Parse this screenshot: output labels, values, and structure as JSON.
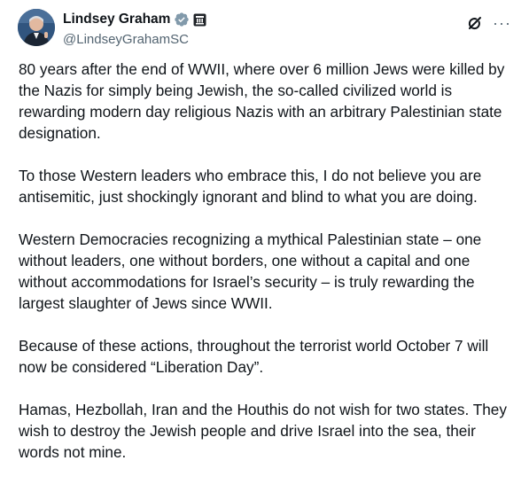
{
  "author": {
    "display_name": "Lindsey Graham",
    "handle": "@LindseyGrahamSC",
    "verified_color": "#829AAB"
  },
  "icons": {
    "verified": "verified-badge-icon",
    "affiliation": "government-affiliation-icon",
    "grok": "grok-icon",
    "more": "more-options-icon"
  },
  "tweet": {
    "paragraphs": [
      "80 years after the end of WWII, where over 6 million Jews were killed by the Nazis for simply being Jewish, the so-called civilized world is rewarding modern day religious Nazis with an arbitrary Palestinian state designation.",
      "To those Western leaders who embrace this, I do not believe you are antisemitic, just shockingly ignorant and blind to what you are doing.",
      "Western Democracies recognizing a mythical Palestinian state – one without leaders, one without borders, one without a capital and one without accommodations for Israel’s security – is truly rewarding the largest slaughter of Jews since WWII.",
      "Because of these actions, throughout the terrorist world October 7 will now be considered “Liberation Day”.",
      "Hamas, Hezbollah, Iran and the Houthis do not wish for two states. They wish to destroy the Jewish people and drive Israel into the sea, their words not mine."
    ]
  }
}
